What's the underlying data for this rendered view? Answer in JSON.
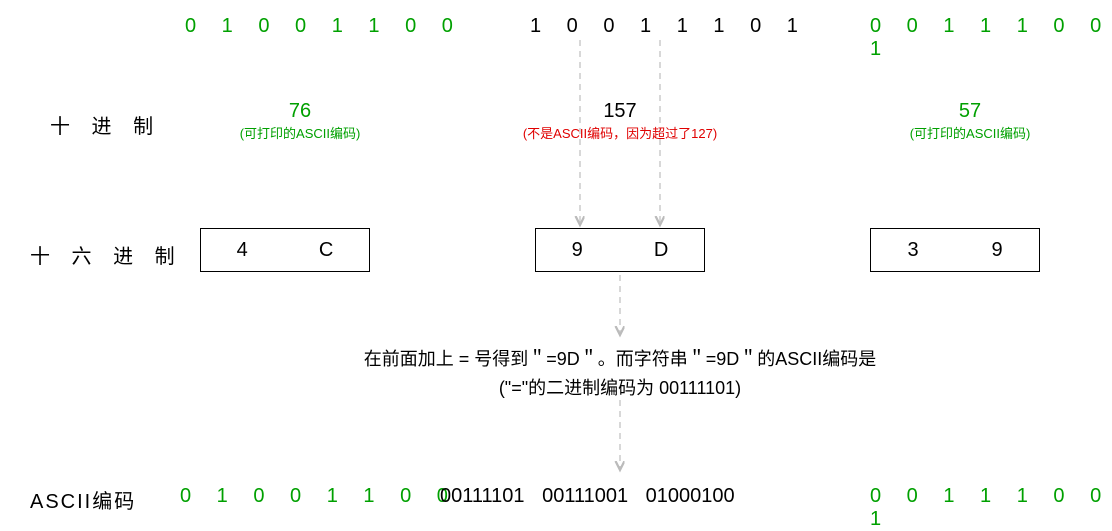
{
  "binary_row": {
    "b1": "0 1 0 0 1 1 0 0",
    "b2": "1 0 0 1 1 1 0 1",
    "b3": "0 0 1 1 1 0 0 1"
  },
  "labels": {
    "decimal": "十 进 制",
    "hex": "十 六 进 制",
    "ascii": "ASCII编码"
  },
  "decimal": {
    "d1": "76",
    "d1_note": "(可打印的ASCII编码)",
    "d2": "157",
    "d2_note": "(不是ASCII编码，因为超过了127)",
    "d3": "57",
    "d3_note": "(可打印的ASCII编码)"
  },
  "hex": {
    "h1a": "4",
    "h1b": "C",
    "h2a": "9",
    "h2b": "D",
    "h3a": "3",
    "h3b": "9"
  },
  "explain": {
    "line1": "在前面加上 = 号得到＂=9D＂。而字符串＂=9D＂的ASCII编码是",
    "line2": "(\"=\"的二进制编码为 00111101)"
  },
  "ascii": {
    "a1": "0 1 0 0 1 1 0 0",
    "a2": "00111101    00111001    01000100",
    "a3": "0 0 1 1 1 0 0 1"
  }
}
